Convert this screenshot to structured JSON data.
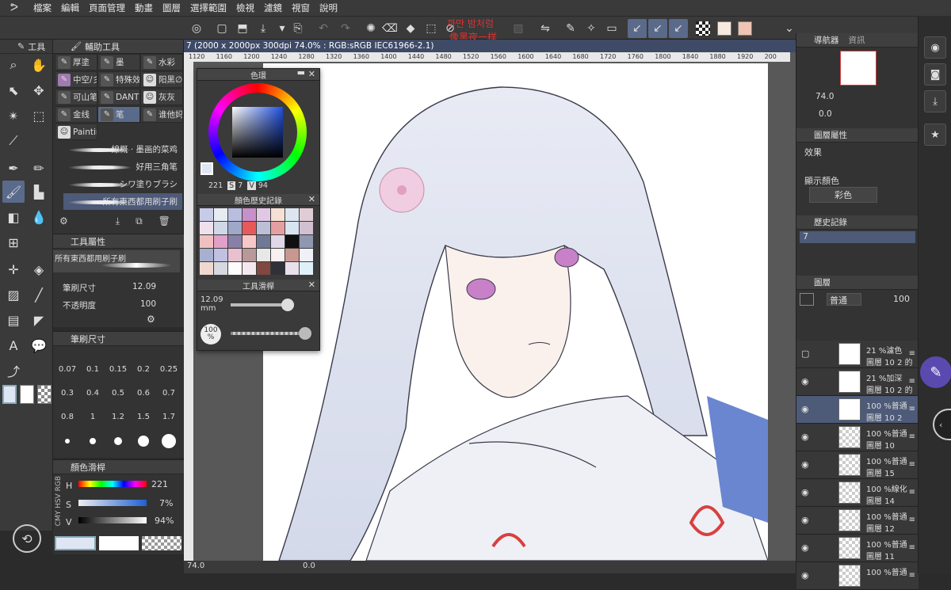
{
  "menu": [
    "檔案",
    "編輯",
    "頁面管理",
    "動畫",
    "圖層",
    "選擇範圍",
    "檢視",
    "濾鏡",
    "視窗",
    "說明"
  ],
  "notice": {
    "line1": "까만 밤처럼",
    "line2": "像黑夜一样"
  },
  "colors": {
    "accent": "#5a6a8a",
    "notice": "#e03030",
    "main_color": "#dfe6f3",
    "sub_color": "#ffffff",
    "swatch1": "#f6e9e0",
    "swatch2": "#efc4b4"
  },
  "toolstrip": {
    "title": "工具"
  },
  "subtool": {
    "title": "輔助工具",
    "buttons": [
      "厚塗",
      "墨",
      "水彩",
      "中空/彡",
      "特殊效",
      "阳黑∅",
      "可山笔",
      "DANT'",
      "灰灰",
      "金线",
      "笔",
      "谁他妈",
      "Paintin"
    ],
    "brushes": [
      "線概 · 墨画的菜鸡",
      "好用三角笔",
      "シワ塗りブラシ",
      "所有東西都用刷子刷"
    ]
  },
  "toolprop": {
    "title": "工具屬性",
    "brush_name": "所有東西都用刷子刷",
    "size_label": "筆刷尺寸",
    "size_value": "12.09",
    "opacity_label": "不透明度",
    "opacity_value": "100"
  },
  "brushsize": {
    "title": "筆刷尺寸",
    "values": [
      "0.07",
      "0.1",
      "0.15",
      "0.2",
      "0.25",
      "0.3",
      "0.4",
      "0.5",
      "0.6",
      "0.7",
      "0.8",
      "1",
      "1.2",
      "1.5",
      "1.7"
    ]
  },
  "colorslider": {
    "title": "顏色滑桿",
    "tabs": [
      "RGB",
      "HSV",
      "CMY"
    ],
    "h_label": "H",
    "h_value": "221",
    "s_label": "S",
    "s_value": "7%",
    "v_label": "V",
    "v_value": "94%"
  },
  "float": {
    "colorwheel_title": "色環",
    "h": "221",
    "s_label": "S",
    "s": "7",
    "v_label": "V",
    "v": "94",
    "history_title": "顏色歷史記錄",
    "history_colors": [
      "#c8cbe8",
      "#e7ecf2",
      "#b9bde0",
      "#c890c8",
      "#e3c8e6",
      "#f5e0d5",
      "#dde6f0",
      "#e0ccd4",
      "#f0e0ec",
      "#d0d8e8",
      "#a0a8c8",
      "#e85a5a",
      "#bcc0d6",
      "#e4a0a0",
      "#d8e4f0",
      "#d0c0d0",
      "#f0c0c0",
      "#e0a0c8",
      "#8880a8",
      "#f8c8c8",
      "#707898",
      "#e0d8e8",
      "#101010",
      "#9098b0",
      "#a8b0d0",
      "#c0c0e0",
      "#e8c0d0",
      "#b89898",
      "#e8e8e8",
      "#f8f0f0",
      "#c89890",
      "#f0f0f8",
      "#f0d8d0",
      "#d8d8e0",
      "#fcfcfc",
      "#f4e8f0",
      "#804840",
      "#303038",
      "#e8e0ec",
      "#e0f0f8"
    ],
    "toolslider_title": "工具滑桿",
    "size_value": "12.09",
    "size_unit": "mm",
    "opacity_value": "100",
    "opacity_unit": "%"
  },
  "document": {
    "tab_title": "7 (2000 x 2000px 300dpi 74.0% : RGB:sRGB IEC61966-2.1)",
    "ruler_ticks": [
      "1120",
      "1160",
      "1200",
      "1240",
      "1280",
      "1320",
      "1360",
      "1400",
      "1440",
      "1480",
      "1520",
      "1560",
      "1600",
      "1640",
      "1680",
      "1720",
      "1760",
      "1800",
      "1840",
      "1880",
      "1920",
      "200"
    ]
  },
  "status": {
    "zoom": "74.0",
    "angle": "0.0"
  },
  "navigator": {
    "title": "導航器",
    "info_tab": "資訊",
    "zoom": "74.0",
    "angle": "0.0"
  },
  "layerprop": {
    "title": "圖層屬性",
    "effect_label": "效果",
    "display_color_label": "顯示顏色",
    "display_color_value": "彩色"
  },
  "history": {
    "title": "歷史記錄",
    "item": "7"
  },
  "layers": {
    "title": "圖層",
    "blend": "普通",
    "opacity": "100",
    "items": [
      {
        "l1": "21 %濾色",
        "l2": "圖層 10 2 的",
        "thumb": "img",
        "eye": false
      },
      {
        "l1": "21 %加深",
        "l2": "圖層 10 2 的",
        "thumb": "img",
        "eye": true
      },
      {
        "l1": "100 %普通",
        "l2": "圖層 10 2",
        "thumb": "img",
        "eye": true,
        "sel": true
      },
      {
        "l1": "100 %普通",
        "l2": "圖層 10",
        "thumb": "checker",
        "eye": true
      },
      {
        "l1": "100 %普通",
        "l2": "圖層 15",
        "thumb": "checker",
        "eye": true
      },
      {
        "l1": "100 %線化",
        "l2": "圖層 14",
        "thumb": "checker",
        "eye": true
      },
      {
        "l1": "100 %普通",
        "l2": "圖層 12",
        "thumb": "checker",
        "eye": true
      },
      {
        "l1": "100 %普通",
        "l2": "圖層 11",
        "thumb": "checker",
        "eye": true
      },
      {
        "l1": "100 %普通",
        "l2": "",
        "thumb": "checker",
        "eye": true
      }
    ]
  }
}
